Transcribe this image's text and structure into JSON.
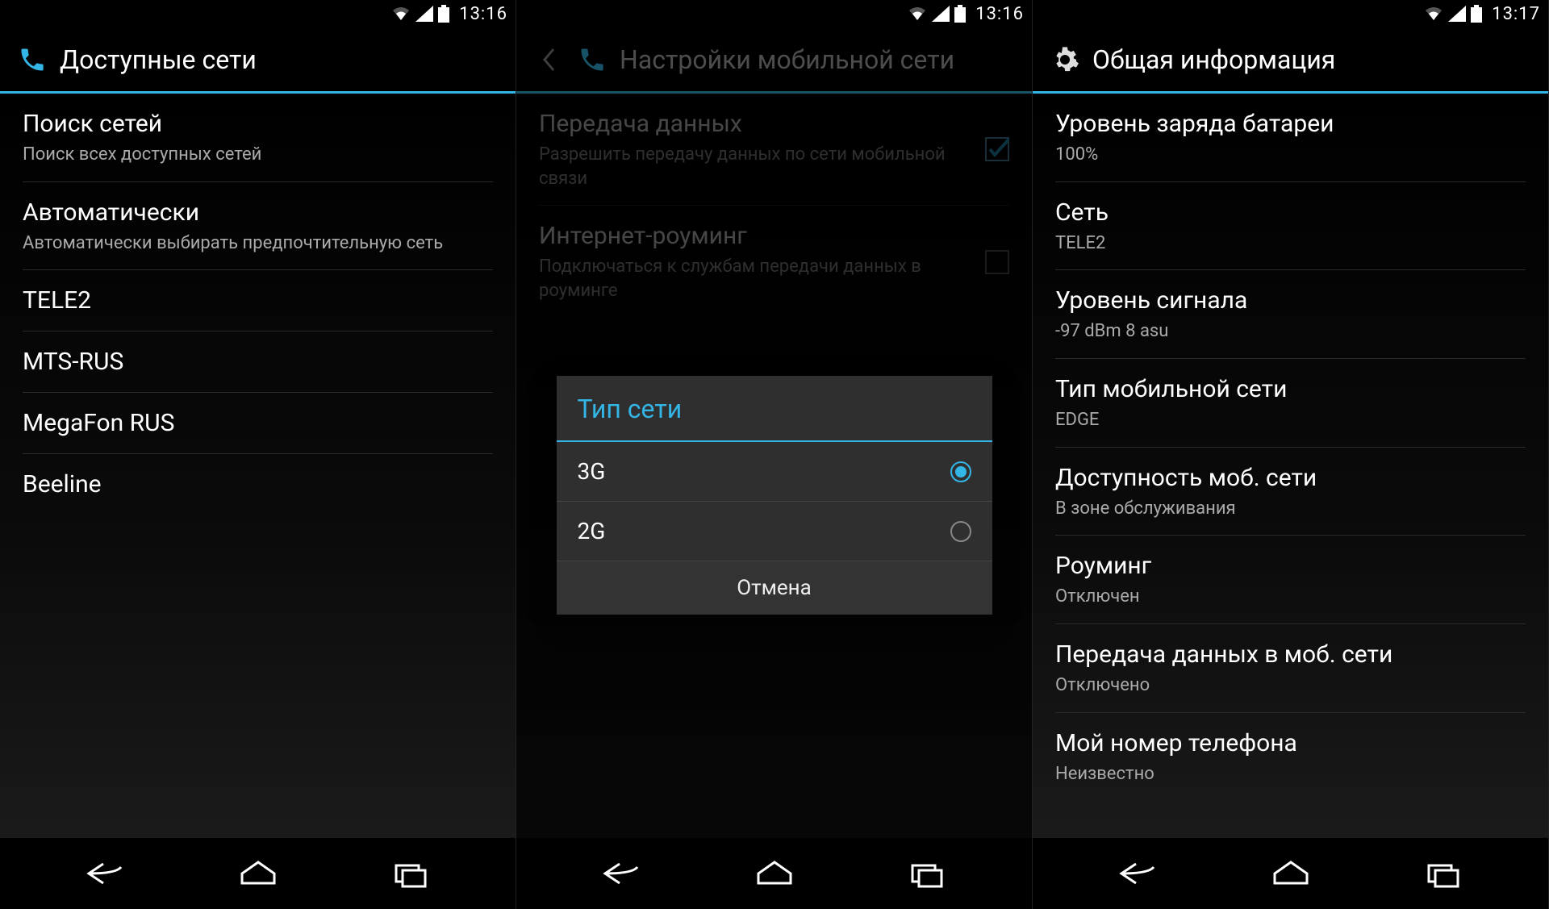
{
  "screens": {
    "available": {
      "time": "13:16",
      "header": "Доступные сети",
      "items": [
        {
          "label": "Поиск сетей",
          "sub": "Поиск всех доступных сетей"
        },
        {
          "label": "Автоматически",
          "sub": "Автоматически выбирать предпочтительную сеть"
        },
        {
          "label": "TELE2"
        },
        {
          "label": "MTS-RUS"
        },
        {
          "label": "MegaFon RUS"
        },
        {
          "label": "Beeline"
        }
      ]
    },
    "mobile": {
      "time": "13:16",
      "header": "Настройки мобильной сети",
      "items": [
        {
          "label": "Передача данных",
          "sub": "Разрешить передачу данных по сети мобильной связи",
          "checked": true
        },
        {
          "label": "Интернет-роуминг",
          "sub": "Подключаться к службам передачи данных в роуминге",
          "checked": false
        }
      ],
      "dialog": {
        "title": "Тип сети",
        "options": [
          {
            "label": "3G",
            "selected": true
          },
          {
            "label": "2G",
            "selected": false
          }
        ],
        "cancel": "Отмена"
      }
    },
    "about": {
      "time": "13:17",
      "header": "Общая информация",
      "items": [
        {
          "label": "Уровень заряда батареи",
          "sub": "100%"
        },
        {
          "label": "Сеть",
          "sub": "TELE2"
        },
        {
          "label": "Уровень сигнала",
          "sub": "-97 dBm   8 asu"
        },
        {
          "label": "Тип мобильной сети",
          "sub": "EDGE"
        },
        {
          "label": "Доступность моб. сети",
          "sub": "В зоне обслуживания"
        },
        {
          "label": "Роуминг",
          "sub": "Отключен"
        },
        {
          "label": "Передача данных в моб. сети",
          "sub": "Отключено"
        },
        {
          "label": "Мой номер телефона",
          "sub": "Неизвестно"
        }
      ]
    }
  }
}
